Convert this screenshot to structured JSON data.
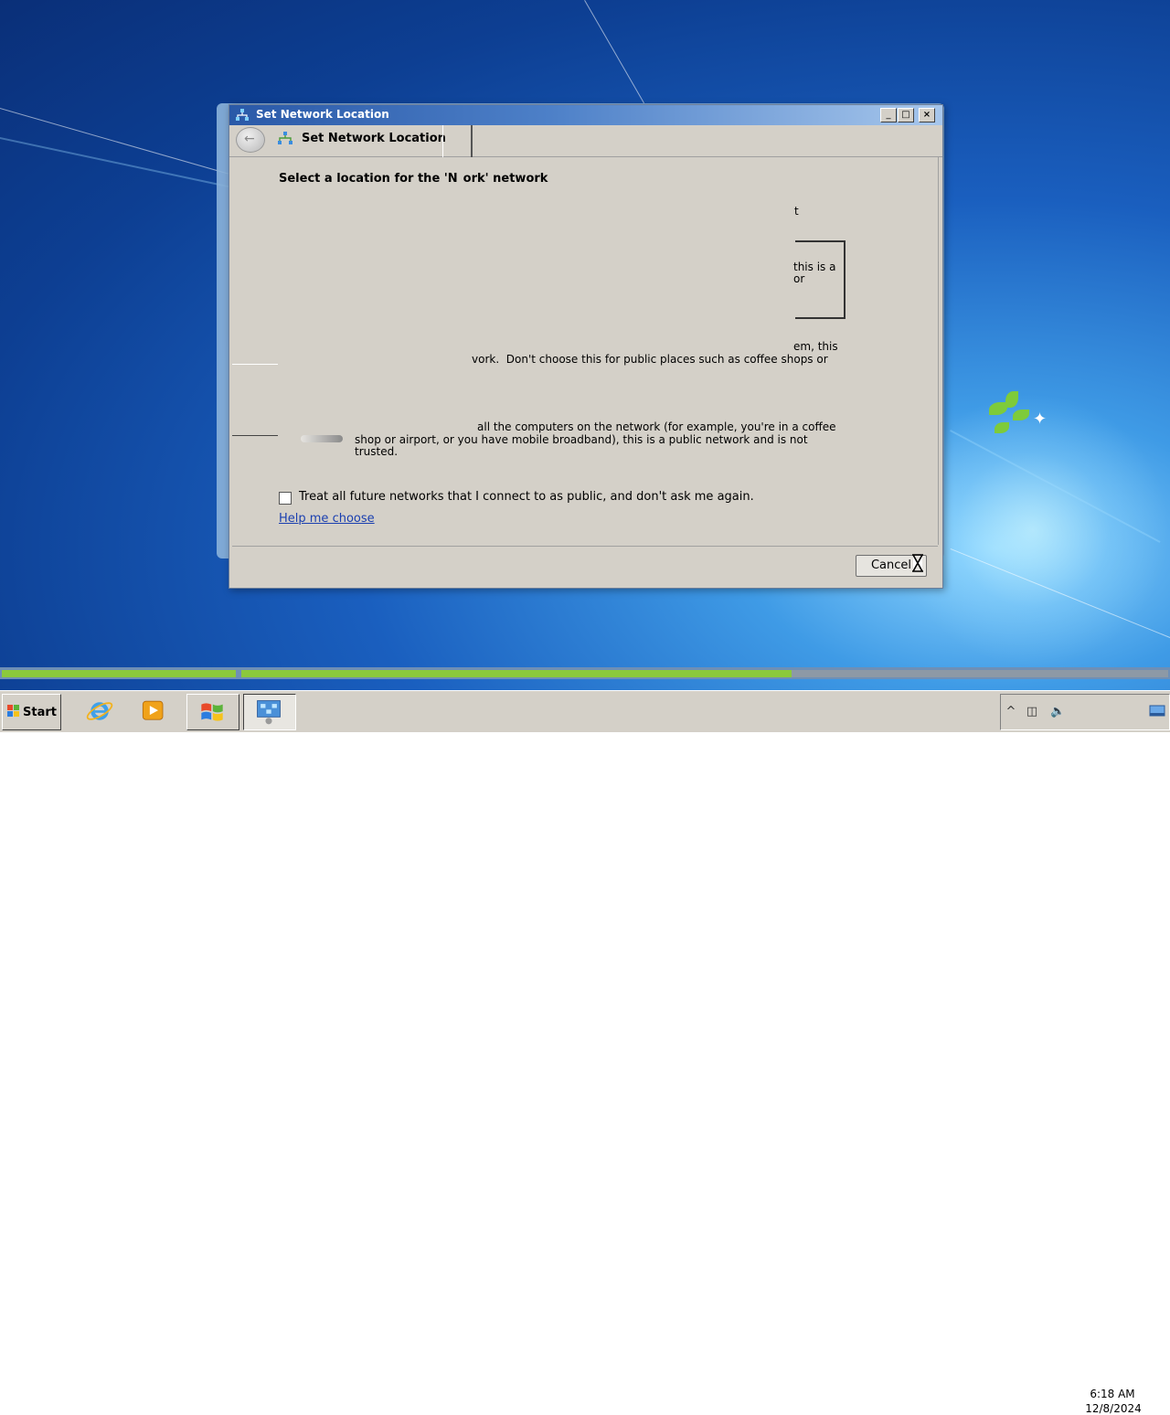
{
  "window": {
    "title": "Set Network Location",
    "nav_title": "Set Network Location",
    "heading": "Select a location for the 'N",
    "heading_end": "ork' network",
    "fragments": {
      "line1": "t",
      "line2a": "this is a",
      "line2b": "or",
      "line3a": "em, this",
      "line3b": "vork.  Don't choose this for public places such as coffee shops or",
      "public1": "all the computers on the network (for example, you're in a coffee",
      "public2": "shop or airport, or you have mobile broadband), this is a public network and is not",
      "public3": "trusted."
    },
    "checkbox_label": "Treat all future networks that I connect to as public, and don't ask me again.",
    "checkbox_checked": false,
    "help_link": "Help me choose",
    "cancel_label": "Cancel",
    "controls": {
      "minimize": "_",
      "maximize": "□",
      "close": "×"
    }
  },
  "taskbar": {
    "start_label": "Start",
    "items": [
      "internet-explorer",
      "windows-media-player",
      "windows-explorer",
      "network-control-panel"
    ],
    "tray_expand": "^",
    "clock_time": "6:18 AM",
    "clock_date": "12/8/2024"
  },
  "progress": {
    "segment1": 0.2,
    "segment2": 0.47
  },
  "colors": {
    "accent": "#2a59a8",
    "link": "#1a3fb0",
    "progress": "#8bc93c"
  }
}
